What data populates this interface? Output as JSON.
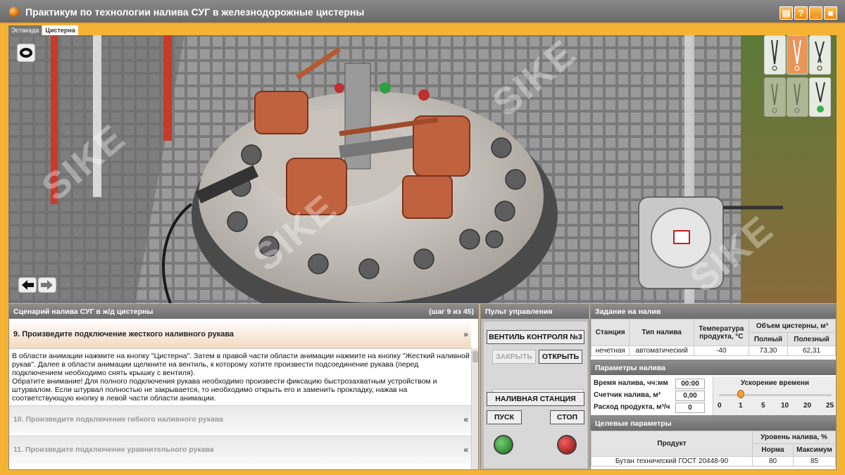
{
  "window": {
    "title": "Практикум по технологии налива СУГ в железнодорожные цистерны",
    "controls": [
      {
        "name": "book-icon",
        "glyph": "▤"
      },
      {
        "name": "help-icon",
        "glyph": "?"
      },
      {
        "name": "minimize-icon",
        "glyph": "_"
      },
      {
        "name": "close-icon",
        "glyph": "■"
      }
    ]
  },
  "viewport": {
    "tabs": [
      {
        "label": "Эстакада",
        "active": false
      },
      {
        "label": "Цистерна",
        "active": true
      }
    ],
    "watermark": "SIKE",
    "tools": [
      {
        "name": "rigid-hose-tool",
        "state": "normal"
      },
      {
        "name": "valve-tool",
        "state": "selected"
      },
      {
        "name": "flexible-hose-tool",
        "state": "normal"
      },
      {
        "name": "equalizing-hose-tool",
        "state": "disabled"
      },
      {
        "name": "pressure-tool",
        "state": "disabled"
      },
      {
        "name": "grounding-tool",
        "state": "active"
      }
    ]
  },
  "scenario": {
    "title": "Сценарий налива СУГ в ж/д цистерны",
    "step_counter": "(шаг 9 из 45)",
    "current_step": {
      "title": "9.  Произведите подключение жесткого наливного рукава",
      "text": "В области анимации нажмите на кнопку \"Цистерна\". Затем в правой части области анимации нажмите на кнопку \"Жесткий наливной рукав\". Далее в области анимации щелкните на вентиль, к которому хотите произвести подсоединение рукава (перед подключением необходимо снять крышку с вентиля).\nОбратите внимание! Для полного подключения рукава необходимо произвести фиксацию быстрозахватным устройством и штурвалом. Если штурвал полностью не закрывается, то необходимо открыть его и заменить прокладку, нажав на соответствующую кнопку в левой части области анимации.",
      "chevron": "«"
    },
    "steps": [
      {
        "title": "10. Произведите подключение гибкого наливного рукава",
        "chevron": "«"
      },
      {
        "title": "11. Произведите подключение уравнительного рукава",
        "chevron": "«"
      }
    ]
  },
  "control": {
    "title": "Пульт управления",
    "valve_label": "ВЕНТИЛЬ КОНТРОЛЯ №3",
    "close_label": "ЗАКРЫТЬ",
    "open_label": "ОТКРЫТЬ",
    "progress": 0,
    "station_label": "НАЛИВНАЯ СТАНЦИЯ",
    "start_label": "ПУСК",
    "stop_label": "СТОП",
    "start_color": "#2a8a2a",
    "stop_color": "#b41818"
  },
  "task": {
    "title": "Задание на налив",
    "headers": {
      "station": "Станция",
      "type": "Тип налива",
      "temperature": "Температура продукта, °С",
      "volume": "Объем цистерны, м³",
      "full": "Полный",
      "useful": "Полезный"
    },
    "row": {
      "station": "нечетная",
      "type": "автоматический",
      "temperature": "-40",
      "full": "73,30",
      "useful": "62,31"
    }
  },
  "params": {
    "title": "Параметры налива",
    "time_label": "Время налива, чч:мм",
    "time_value": "00:00",
    "counter_label": "Счетчик налива, м³",
    "counter_value": "0,00",
    "flow_label": "Расход продукта, м³/ч",
    "flow_value": "0",
    "speed_title": "Ускорение времени",
    "speed_ticks": [
      "0",
      "1",
      "5",
      "10",
      "20",
      "25"
    ],
    "speed_value": 1
  },
  "target": {
    "title": "Целевые параметры",
    "product_header": "Продукт",
    "level_header": "Уровень налива, %",
    "norm_header": "Норма",
    "max_header": "Максимум",
    "product": "Бутан технический ГОСТ 20448-90",
    "norm": "80",
    "max": "85"
  }
}
